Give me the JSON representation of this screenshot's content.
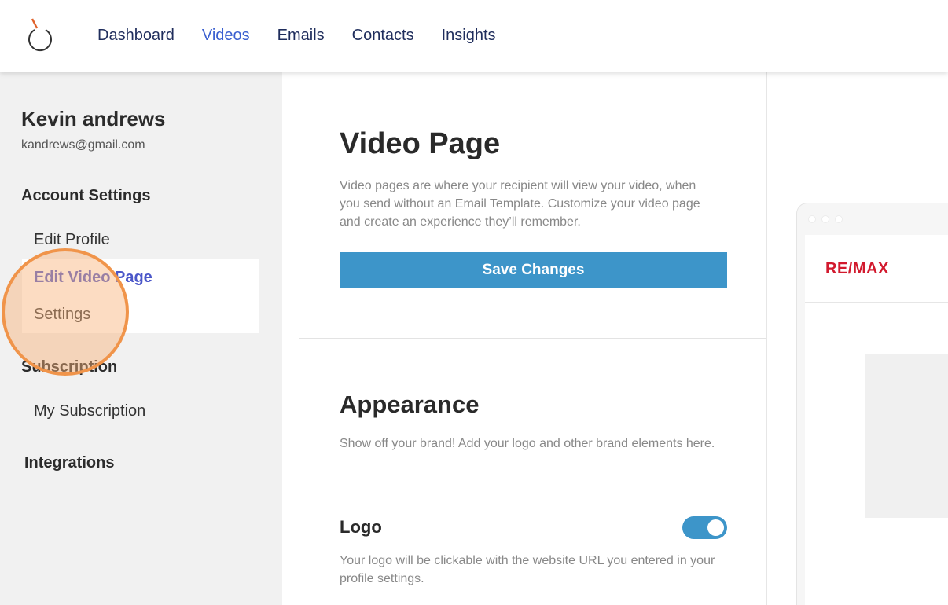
{
  "nav": {
    "items": [
      "Dashboard",
      "Videos",
      "Emails",
      "Contacts",
      "Insights"
    ],
    "active": "Videos"
  },
  "sidebar": {
    "user_name": "Kevin andrews",
    "user_email": "kandrews@gmail.com",
    "account_settings_label": "Account Settings",
    "edit_profile": "Edit Profile",
    "edit_video_page": "Edit Video Page",
    "settings": "Settings",
    "subscription_label": "Subscription",
    "my_subscription": "My Subscription",
    "integrations_label": "Integrations"
  },
  "main": {
    "title": "Video Page",
    "description": "Video pages are where your recipient will view your video, when you send without an Email Template. Customize your video page and create an experience they’ll remember.",
    "save_label": "Save Changes",
    "appearance_title": "Appearance",
    "appearance_desc": "Show off your brand! Add your logo and other brand elements here.",
    "logo_title": "Logo",
    "logo_toggle_on": true,
    "logo_desc": "Your logo will be clickable with the website URL you entered in your profile settings."
  },
  "preview": {
    "brand": "RE/MAX"
  },
  "colors": {
    "accent": "#3d95c9",
    "nav_active": "#3a5fd0",
    "highlight": "#f0944a",
    "brand_red": "#d21a2e"
  }
}
